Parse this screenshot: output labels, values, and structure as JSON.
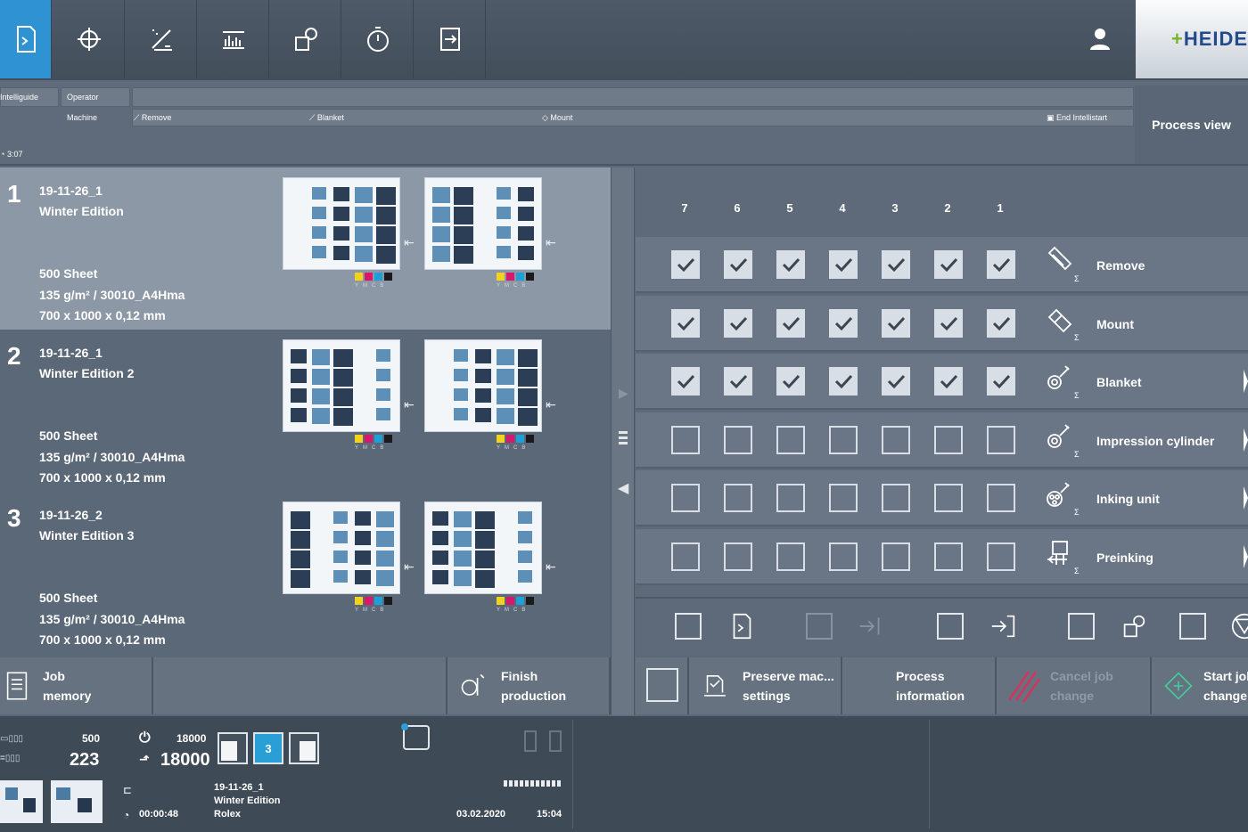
{
  "brand": {
    "logo_text": "HEIDEL",
    "logo_accent": "#7bb32e",
    "accent": "#2f93d3"
  },
  "toolbar": {
    "icons": [
      "job-icon",
      "register-icon",
      "ink-zone-icon",
      "ink-profile-icon",
      "color-measure-icon",
      "timer-icon",
      "plate-change-icon"
    ],
    "user_icon": "user-icon"
  },
  "strip": {
    "intelliguide": "Intelliguide",
    "operator": "Operator",
    "machine": "Machine",
    "timer": "3:07",
    "steps": [
      "Remove",
      "Blanket",
      "Mount",
      "End Intellistart"
    ],
    "process_view": "Process view"
  },
  "jobs": [
    {
      "num": "1",
      "id": "19-11-26_1",
      "name": "Winter Edition",
      "sheets": "500 Sheet",
      "paper": "135 g/m²  /  30010_A4Hma",
      "size": "700 x 1000 x 0,12 mm",
      "selected": true
    },
    {
      "num": "2",
      "id": "19-11-26_1",
      "name": "Winter Edition 2",
      "sheets": "500 Sheet",
      "paper": "135 g/m²  /  30010_A4Hma",
      "size": "700 x 1000 x 0,12 mm",
      "selected": false
    },
    {
      "num": "3",
      "id": "19-11-26_2",
      "name": "Winter Edition 3",
      "sheets": "500 Sheet",
      "paper": "135 g/m²  /  30010_A4Hma",
      "size": "700 x 1000 x 0,12 mm",
      "selected": false
    }
  ],
  "cmyk_label": "YMCB",
  "cmyk_colors": [
    "#f2d21c",
    "#d8186c",
    "#1e9fd8",
    "#1b1b1b"
  ],
  "units": [
    "7",
    "6",
    "5",
    "4",
    "3",
    "2",
    "1"
  ],
  "operations": [
    {
      "label": "Remove",
      "icon": "plate-remove-icon",
      "checked": true
    },
    {
      "label": "Mount",
      "icon": "plate-mount-icon",
      "checked": true
    },
    {
      "label": "Blanket",
      "icon": "blanket-wash-icon",
      "checked": true
    },
    {
      "label": "Impression cylinder",
      "icon": "impression-cylinder-wash-icon",
      "checked": false
    },
    {
      "label": "Inking unit",
      "icon": "inking-unit-wash-icon",
      "checked": false
    },
    {
      "label": "Preinking",
      "icon": "preinking-icon",
      "checked": false
    }
  ],
  "bottom": {
    "job_memory": "Job\nmemory",
    "finish_production": "Finish\nproduction",
    "preserve": "Preserve mac...\nsettings",
    "process_info": "Process\ninformation",
    "cancel": "Cancel job\nchange",
    "start": "Start job\nchange"
  },
  "status": {
    "counter_target": "500",
    "counter_value": "223",
    "speed_target": "18000",
    "speed_value": "18000",
    "pile_indicator": "3",
    "job_id": "19-11-26_1",
    "job_name": "Winter Edition",
    "customer": "Rolex",
    "elapsed": "00:00:48",
    "date": "03.02.2020",
    "time": "15:04"
  }
}
